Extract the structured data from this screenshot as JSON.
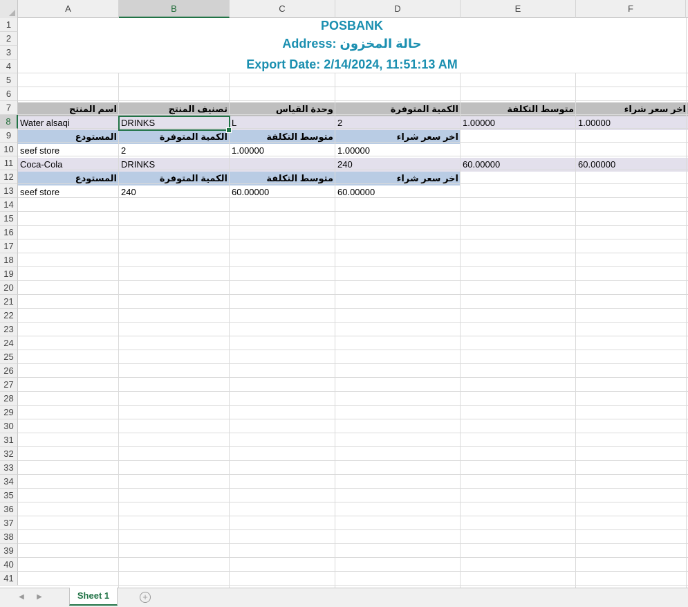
{
  "columns": [
    "A",
    "B",
    "C",
    "D",
    "E",
    "F"
  ],
  "selected_cell": "B8",
  "rows": [
    "1",
    "2",
    "3",
    "4",
    "5",
    "6",
    "7",
    "8",
    "9",
    "10",
    "11",
    "12",
    "13",
    "14",
    "15",
    "16",
    "17",
    "18",
    "19",
    "20",
    "21",
    "22",
    "23",
    "24",
    "25",
    "26",
    "27",
    "28",
    "29",
    "30",
    "31",
    "32",
    "33",
    "34",
    "35",
    "36",
    "37",
    "38",
    "39",
    "40",
    "41"
  ],
  "header": {
    "company": "POSBANK",
    "address": "Address: حالة المخزون",
    "export_date": "Export Date: 2/14/2024, 11:51:13 AM"
  },
  "product_headers": [
    "اسم المنتج",
    "تصنيف المنتج",
    "وحدة القياس",
    "الكمية المتوفرة",
    "متوسط التكلفة",
    "اخر سعر شراء"
  ],
  "warehouse_headers": [
    "المستودع",
    "الكمية المتوفرة",
    "متوسط التكلفة",
    "اخر سعر شراء"
  ],
  "products": [
    {
      "name": "Water alsaqi",
      "category": "DRINKS",
      "unit": "L",
      "quantity": "2",
      "avg_cost": "1.00000",
      "last_price": "1.00000",
      "warehouse": {
        "name": "seef store",
        "quantity": "2",
        "avg_cost": "1.00000",
        "last_price": "1.00000"
      }
    },
    {
      "name": "Coca-Cola",
      "category": "DRINKS",
      "unit": "",
      "quantity": "240",
      "avg_cost": "60.00000",
      "last_price": "60.00000",
      "warehouse": {
        "name": "seef store",
        "quantity": "240",
        "avg_cost": "60.00000",
        "last_price": "60.00000"
      }
    }
  ],
  "sheet_tab": "Sheet 1",
  "icons": [
    "select-all-icon",
    "scroll-left-icon",
    "scroll-right-icon",
    "add-sheet-icon"
  ],
  "colors": {
    "title": "#1a8fb0",
    "header_band": "#bfbfbf",
    "product_row": "#e3e0ec",
    "warehouse_header": "#b9cce4",
    "accent": "#217346"
  }
}
